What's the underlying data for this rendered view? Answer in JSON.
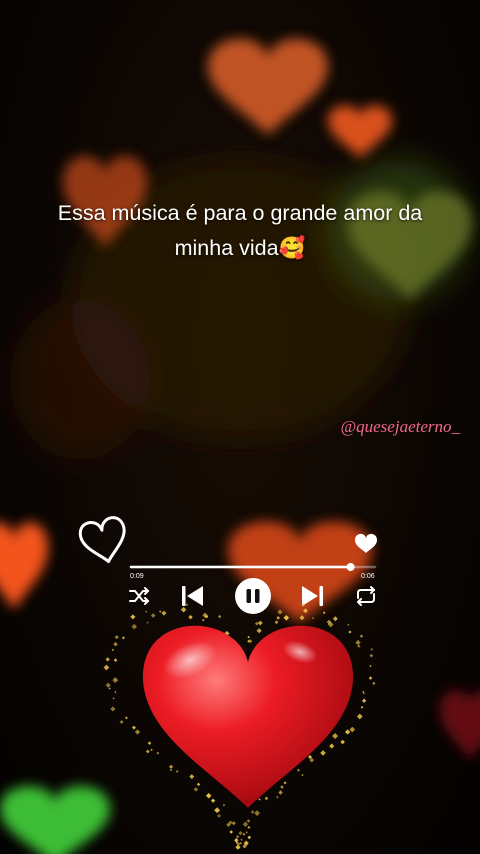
{
  "caption": {
    "line1": "Essa música é para o grande amor da",
    "line2": "minha vida🥰"
  },
  "watermark": "@quesejaeterno_",
  "player": {
    "elapsed": "0:09",
    "total": "0:06",
    "progress": 0.9,
    "liked": true,
    "is_playing": true
  },
  "icons": [
    "outline-heart-icon",
    "like-heart-icon",
    "shuffle-icon",
    "previous-icon",
    "pause-icon",
    "next-icon",
    "repeat-icon",
    "equalizer-icon",
    "red-heart-icon"
  ],
  "colors": {
    "watermark": "#f06a8a",
    "accent": "#ffffff",
    "eq_left": "#4fb6e8",
    "eq_right": "#c8e04a",
    "heart": "#e3121b",
    "sparkle": "#e8c14a"
  }
}
